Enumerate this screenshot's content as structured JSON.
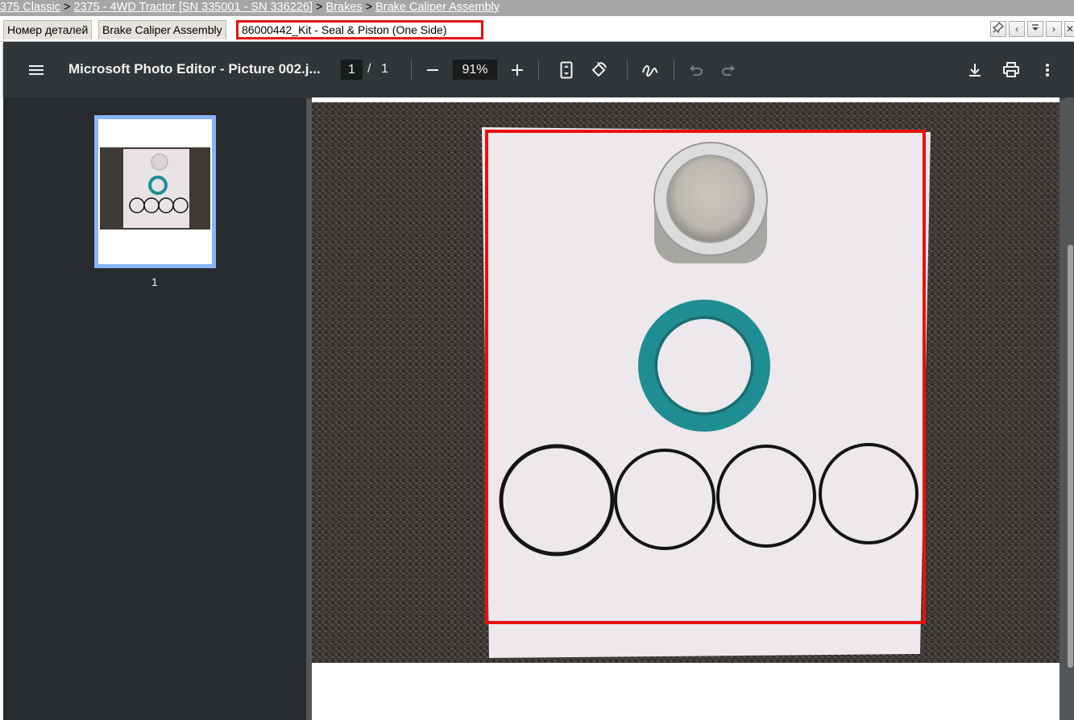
{
  "breadcrumb": {
    "items": [
      "375 Classic",
      "2375 - 4WD Tractor [SN 335001 - SN 336226]",
      "Brakes",
      "Brake Caliper Assembly"
    ],
    "separator": ">"
  },
  "tabs": [
    {
      "label": "Номер деталей"
    },
    {
      "label": "Brake Caliper Assembly"
    },
    {
      "label": "86000442_Kit - Seal & Piston (One Side)"
    }
  ],
  "viewer": {
    "title": "Microsoft Photo Editor - Picture 002.j...",
    "page_current": "1",
    "page_separator": "/",
    "page_total": "1",
    "zoom": "91%",
    "thumbnail_label": "1"
  },
  "colors": {
    "toolbar_bg": "#323639",
    "sidebar_bg": "#282b2d",
    "highlight_red": "#e81010",
    "thumb_selected": "#8ab4f8",
    "seal_teal": "#1f8d94"
  },
  "icons": {
    "menu": "hamburger-icon",
    "zoom_out": "minus-icon",
    "zoom_in": "plus-icon",
    "fit": "fit-page-icon",
    "rotate": "rotate-icon",
    "annotate": "pen-icon",
    "undo": "undo-icon",
    "redo": "redo-icon",
    "download": "download-icon",
    "print": "print-icon",
    "more": "more-vert-icon"
  }
}
